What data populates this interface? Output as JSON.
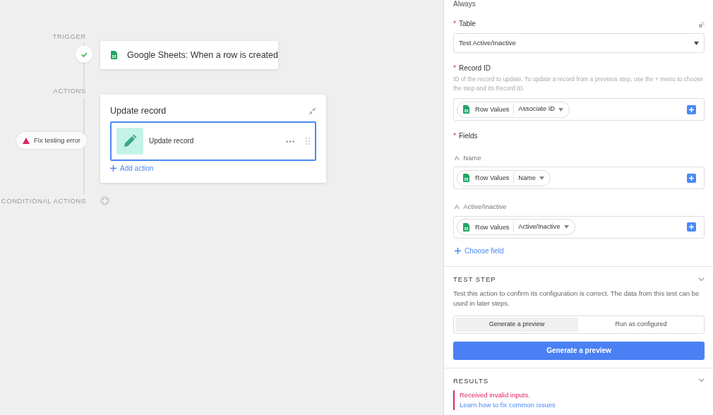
{
  "canvas": {
    "trigger": {
      "label": "TRIGGER",
      "passed": true,
      "title": "Google Sheets: When a row is created"
    },
    "actions_label": "ACTIONS",
    "action_card": {
      "title": "Update record",
      "step": {
        "title": "Update record",
        "selected": true
      },
      "add_action": "Add action"
    },
    "error_badge": "Fix testing error",
    "conditional_label": "CONDITIONAL ACTIONS"
  },
  "panel": {
    "top_text": "Always",
    "table": {
      "required_mark": "*",
      "label": "Table",
      "value": "Test Active/Inactive"
    },
    "record_id": {
      "required_mark": "*",
      "label": "Record ID",
      "hint": "ID of the record to update. To update a record from a previous step, use the + menu to choose the step and its Record ID.",
      "pill": {
        "source": "Row Values",
        "field": "Associate ID"
      }
    },
    "fields": {
      "required_mark": "*",
      "label": "Fields",
      "items": [
        {
          "type_mark": "A",
          "label": "Name",
          "pill": {
            "source": "Row Values",
            "field": "Name"
          }
        },
        {
          "type_mark": "A",
          "label": "Active/Inactive",
          "pill": {
            "source": "Row Values",
            "field": "Active/Inactive"
          }
        }
      ],
      "choose_field": "Choose field"
    },
    "test_step": {
      "title": "TEST STEP",
      "description": "Test this action to confirm its configuration is correct. The data from this test can be used in later steps.",
      "modes": [
        {
          "label": "Generate a preview",
          "selected": true
        },
        {
          "label": "Run as configured",
          "selected": false
        }
      ],
      "button": "Generate a preview"
    },
    "results": {
      "title": "RESULTS",
      "error": "Received invalid inputs.",
      "link": "Learn how to fix common issues"
    }
  }
}
